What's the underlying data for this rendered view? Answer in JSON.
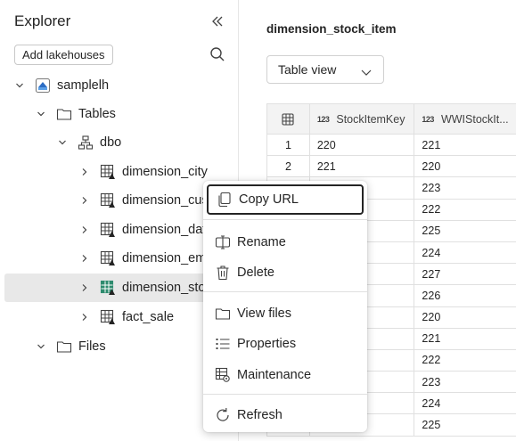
{
  "explorer": {
    "title": "Explorer",
    "add_button": "Add lakehouses",
    "tree": {
      "lakehouse": "samplelh",
      "tables": "Tables",
      "schema": "dbo",
      "items": [
        {
          "label": "dimension_city"
        },
        {
          "label": "dimension_cus"
        },
        {
          "label": "dimension_dat"
        },
        {
          "label": "dimension_em"
        },
        {
          "label": "dimension_sto"
        },
        {
          "label": "fact_sale"
        }
      ],
      "files": "Files"
    }
  },
  "main": {
    "title": "dimension_stock_item",
    "view_select": "Table view",
    "grid": {
      "type_badge": "123",
      "columns": [
        "StockItemKey",
        "WWIStockIt..."
      ],
      "rows": [
        {
          "n": "1",
          "a": "220",
          "b": "221"
        },
        {
          "n": "2",
          "a": "221",
          "b": "220"
        },
        {
          "n": "",
          "a": "",
          "b": "223"
        },
        {
          "n": "",
          "a": "",
          "b": "222"
        },
        {
          "n": "",
          "a": "",
          "b": "225"
        },
        {
          "n": "",
          "a": "",
          "b": "224"
        },
        {
          "n": "",
          "a": "",
          "b": "227"
        },
        {
          "n": "",
          "a": "",
          "b": "226"
        },
        {
          "n": "",
          "a": "",
          "b": "220"
        },
        {
          "n": "",
          "a": "",
          "b": "221"
        },
        {
          "n": "",
          "a": "",
          "b": "222"
        },
        {
          "n": "",
          "a": "",
          "b": "223"
        },
        {
          "n": "",
          "a": "",
          "b": "224"
        },
        {
          "n": "",
          "a": "",
          "b": "225"
        }
      ]
    }
  },
  "context_menu": {
    "copy_url": "Copy URL",
    "rename": "Rename",
    "delete": "Delete",
    "view_files": "View files",
    "properties": "Properties",
    "maintenance": "Maintenance",
    "refresh": "Refresh"
  }
}
